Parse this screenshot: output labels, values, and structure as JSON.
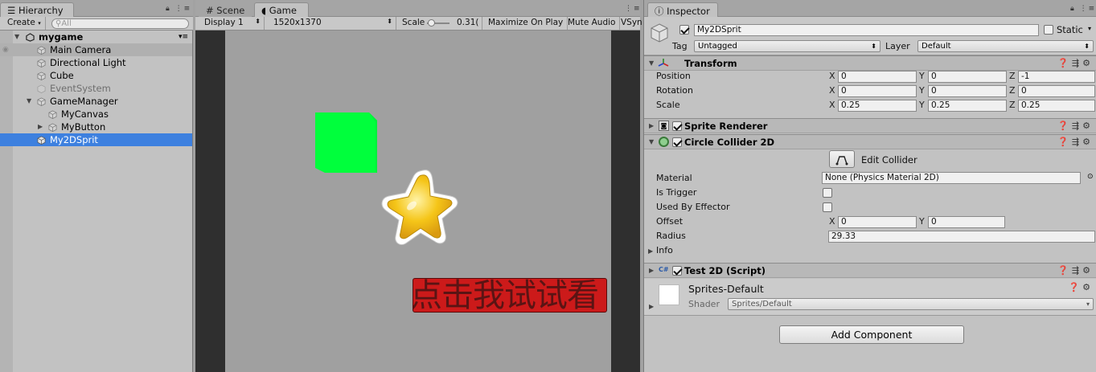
{
  "hierarchy": {
    "tab_label": "Hierarchy",
    "create_label": "Create",
    "search_placeholder": "All",
    "scene_name": "mygame",
    "items": [
      {
        "label": "Main Camera"
      },
      {
        "label": "Directional Light"
      },
      {
        "label": "Cube"
      },
      {
        "label": "EventSystem"
      },
      {
        "label": "GameManager"
      },
      {
        "label": "MyCanvas"
      },
      {
        "label": "MyButton"
      },
      {
        "label": "My2DSprit"
      }
    ]
  },
  "game": {
    "scene_tab": "Scene",
    "game_tab": "Game",
    "display": "Display 1",
    "resolution": "1520x1370",
    "scale_label": "Scale",
    "scale_value": "0.31(",
    "maximize": "Maximize On Play",
    "mute": "Mute Audio",
    "vsync": "VSyn",
    "button_text": "点击我试试看",
    "colors": {
      "cube": "#00ff3c",
      "button": "#cc1a1a",
      "star": "#f5c518"
    }
  },
  "inspector": {
    "tab_label": "Inspector",
    "object_name": "My2DSprit",
    "static_label": "Static",
    "tag_label": "Tag",
    "tag_value": "Untagged",
    "layer_label": "Layer",
    "layer_value": "Default",
    "transform": {
      "title": "Transform",
      "position_label": "Position",
      "rotation_label": "Rotation",
      "scale_label": "Scale",
      "position": {
        "x": "0",
        "y": "0",
        "z": "-1"
      },
      "rotation": {
        "x": "0",
        "y": "0",
        "z": "0"
      },
      "scale": {
        "x": "0.25",
        "y": "0.25",
        "z": "0.25"
      }
    },
    "sprite_renderer": {
      "title": "Sprite Renderer"
    },
    "circle_collider": {
      "title": "Circle Collider 2D",
      "edit_collider": "Edit Collider",
      "material_label": "Material",
      "material_value": "None (Physics Material 2D)",
      "is_trigger_label": "Is Trigger",
      "used_by_effector_label": "Used By Effector",
      "offset_label": "Offset",
      "offset": {
        "x": "0",
        "y": "0"
      },
      "radius_label": "Radius",
      "radius_value": "29.33",
      "info_label": "Info"
    },
    "script": {
      "title": "Test 2D (Script)"
    },
    "material": {
      "name": "Sprites-Default",
      "shader_label": "Shader",
      "shader_value": "Sprites/Default"
    },
    "add_component": "Add Component",
    "axis_x": "X",
    "axis_y": "Y",
    "axis_z": "Z"
  }
}
